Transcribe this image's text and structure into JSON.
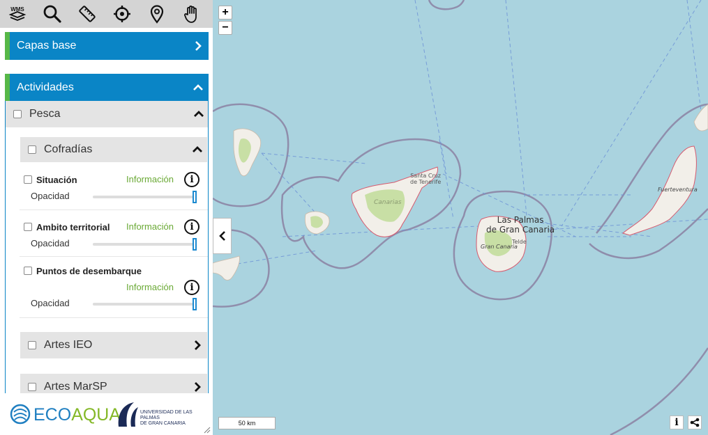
{
  "toolbar": {
    "tools": [
      "wms-icon",
      "search-icon",
      "ruler-icon",
      "locate-icon",
      "marker-icon",
      "hand-icon"
    ],
    "wms_text": "WMS"
  },
  "sections": {
    "capas_base": "Capas base",
    "actividades": "Actividades"
  },
  "groups": {
    "pesca": "Pesca",
    "cofradias": "Cofradías",
    "artes_ieo": "Artes IEO",
    "artes_marsp": "Artes MarSP"
  },
  "layers": [
    {
      "name": "Situación",
      "info": "Información",
      "opacity_label": "Opacidad",
      "opacity": 1.0
    },
    {
      "name": "Ambito territorial",
      "info": "Información",
      "opacity_label": "Opacidad",
      "opacity": 1.0
    },
    {
      "name": "Puntos de desembarque",
      "info": "Información",
      "opacity_label": "Opacidad",
      "opacity": 1.0
    }
  ],
  "logos": {
    "ecoaqua_eco": "ECO",
    "ecoaqua_aqua": "AQUA",
    "ulpgc_line1": "UNIVERSIDAD DE LAS PALMAS",
    "ulpgc_line2": "DE GRAN CANARIA"
  },
  "map": {
    "zoom_in": "+",
    "zoom_out": "−",
    "scale": "50 km",
    "labels": {
      "santa_cruz_1": "Santa Cruz",
      "santa_cruz_2": "de Tenerife",
      "canarias": "Canarias",
      "las_palmas_1": "Las Palmas",
      "las_palmas_2": "de Gran Canaria",
      "telde": "Telde",
      "gran_canaria": "Gran Canaria",
      "fuerteventura": "Fuerteventura"
    },
    "info_btn": "i",
    "colors": {
      "sea": "#aad3df",
      "land": "#f2efe9",
      "green": "#c8dfa5",
      "boundary": "#8d86a6"
    }
  }
}
